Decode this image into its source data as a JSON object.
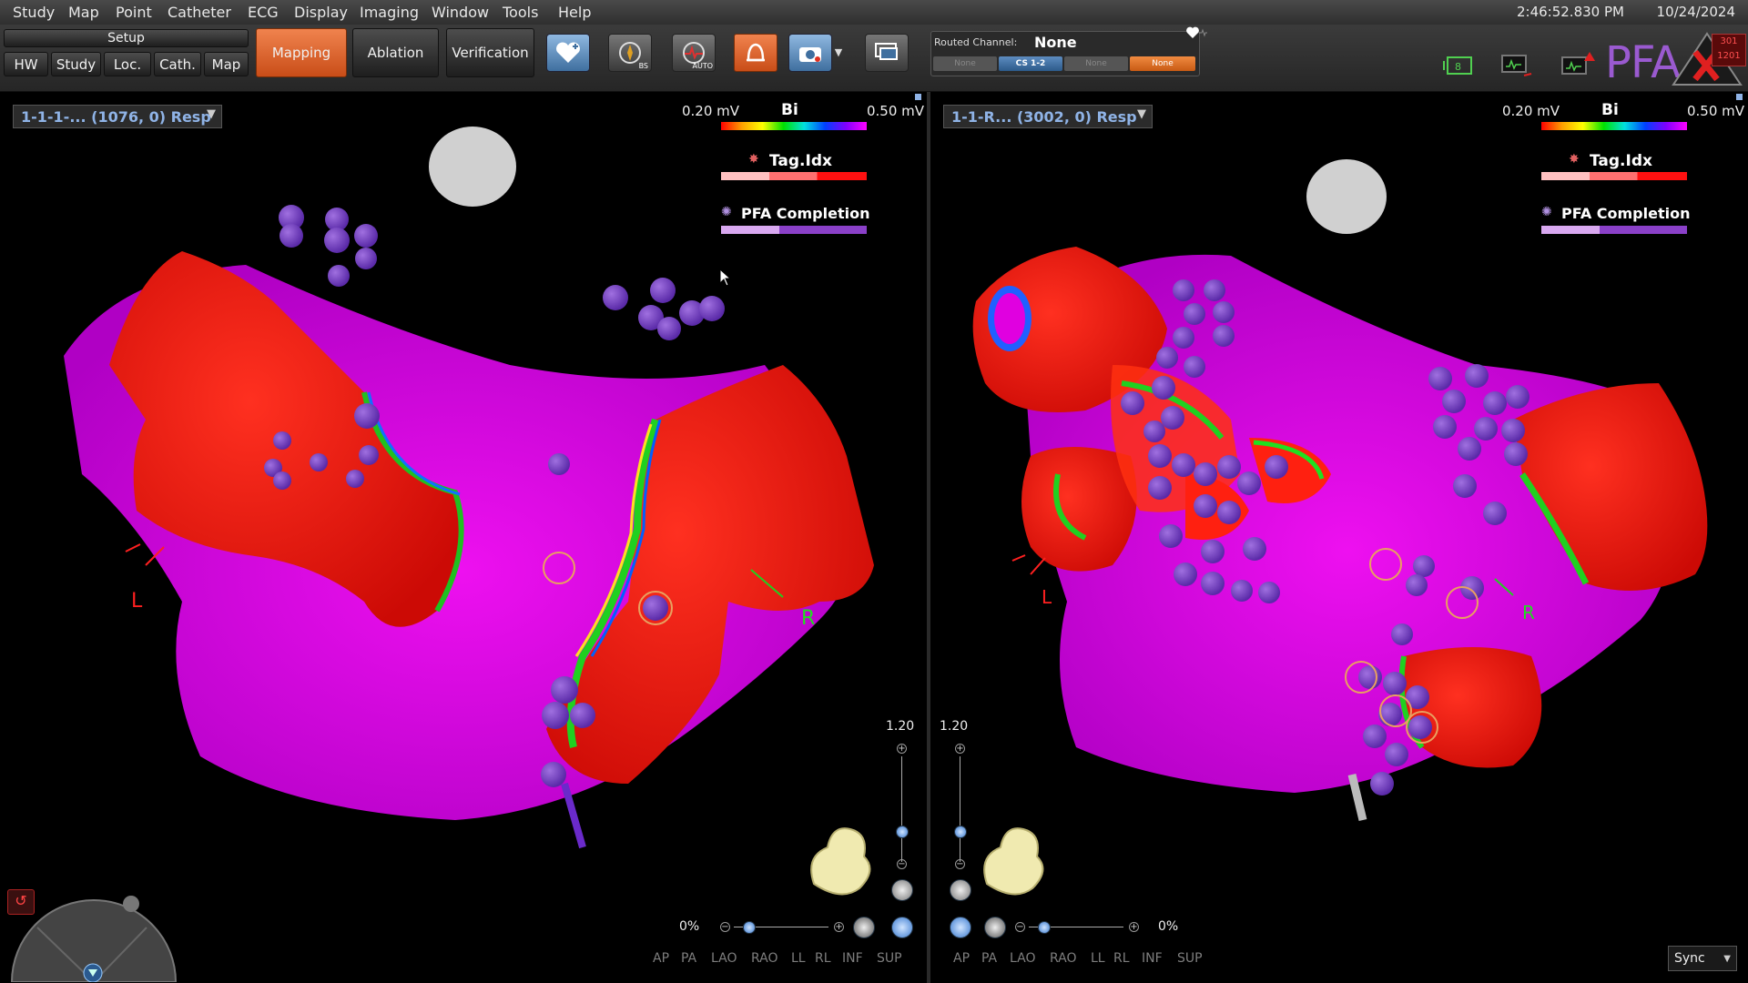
{
  "menu": [
    "Study",
    "Map",
    "Point",
    "Catheter",
    "ECG",
    "Display",
    "Imaging",
    "Window",
    "Tools",
    "Help"
  ],
  "clock": {
    "time": "2:46:52.830 PM",
    "date": "10/24/2024"
  },
  "toolbar": {
    "setup_label": "Setup",
    "setup_tabs": [
      "HW",
      "Study",
      "Loc.",
      "Cath.",
      "Map"
    ],
    "workflow_tabs": [
      "Mapping",
      "Ablation",
      "Verification"
    ],
    "icon_labels": {
      "bs": "BS",
      "auto": "AUTO"
    },
    "routed_channel_label": "Routed Channel:",
    "routed_channel_value": "None",
    "channel_buttons": [
      "None",
      "CS 1-2",
      "None",
      "None"
    ],
    "status_numbers": [
      "301",
      "1201"
    ],
    "pfa_label": "PFA"
  },
  "left_view": {
    "map_selector": "1-1-1-... (1076, 0) Resp",
    "legend_min": "0.20 mV",
    "legend_title": "Bi",
    "legend_max": "0.50 mV",
    "tag_label": "Tag.Idx",
    "pfa_label": "PFA Completion",
    "zoom": "1.20",
    "opacity": "0%",
    "marker_left": "L",
    "marker_right": "R",
    "views": [
      "AP",
      "PA",
      "LAO",
      "RAO",
      "LL",
      "RL",
      "INF",
      "SUP"
    ]
  },
  "right_view": {
    "map_selector": "1-1-R... (3002, 0) Resp",
    "legend_min": "0.20 mV",
    "legend_title": "Bi",
    "legend_max": "0.50 mV",
    "tag_label": "Tag.Idx",
    "pfa_label": "PFA Completion",
    "zoom": "1.20",
    "opacity": "0%",
    "marker_left": "L",
    "marker_right": "R",
    "views": [
      "AP",
      "PA",
      "LAO",
      "RAO",
      "LL",
      "RL",
      "INF",
      "SUP"
    ],
    "sync": "Sync"
  },
  "colors": {
    "tissue_red": "#ff1a0e",
    "tissue_magenta": "#e100e8",
    "lesion": "#7a3fc0",
    "accent_orange": "#e06a30"
  }
}
